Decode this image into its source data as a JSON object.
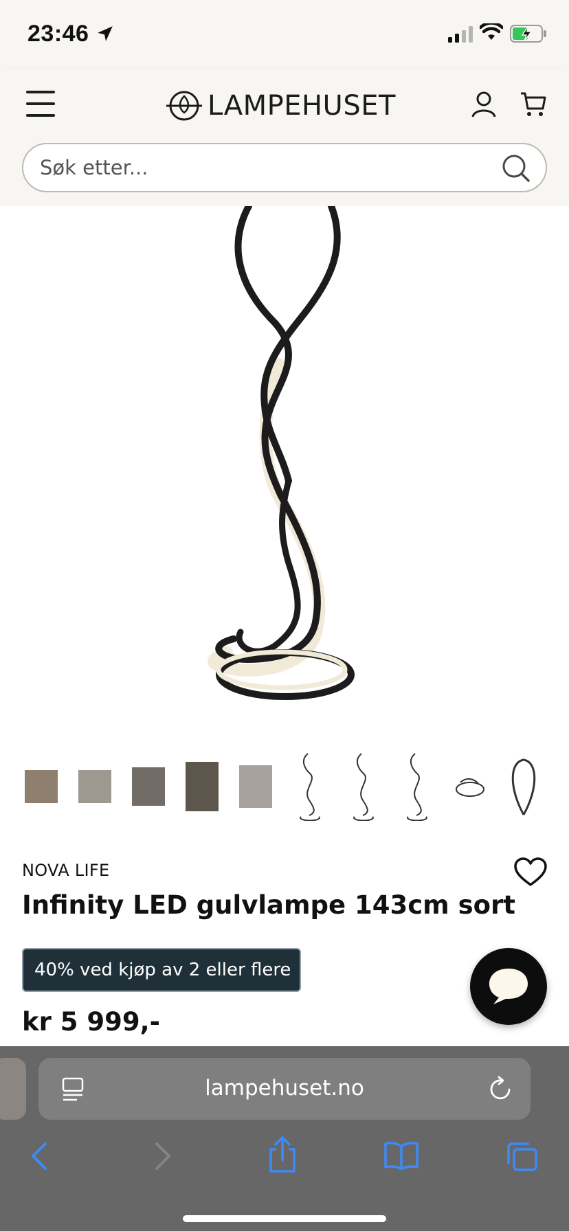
{
  "status_bar": {
    "time": "23:46",
    "icons": [
      "location-arrow-icon",
      "signal-icon",
      "wifi-icon",
      "battery-charging-icon"
    ]
  },
  "header": {
    "logo_text": "LAMPEHUSET",
    "search": {
      "placeholder": "Søk etter..."
    },
    "icons": [
      "menu-icon",
      "logo-mark",
      "account-icon",
      "cart-icon",
      "search-icon"
    ]
  },
  "gallery": {
    "thumbnail_count": 10
  },
  "product": {
    "brand": "NOVA LIFE",
    "title": "Infinity LED gulvlampe 143cm sort",
    "promo": "40% ved kjøp av 2 eller flere",
    "price": "kr 5 999,-"
  },
  "browser": {
    "url": "lampehuset.no",
    "toolbar": [
      "back-icon",
      "forward-icon",
      "share-icon",
      "bookmarks-icon",
      "tabs-icon"
    ]
  },
  "colors": {
    "header_bg": "#f8f6f2",
    "promo_bg": "#1f3039",
    "safari_bg": "#676767",
    "safari_blue": "#3d8bf7"
  }
}
